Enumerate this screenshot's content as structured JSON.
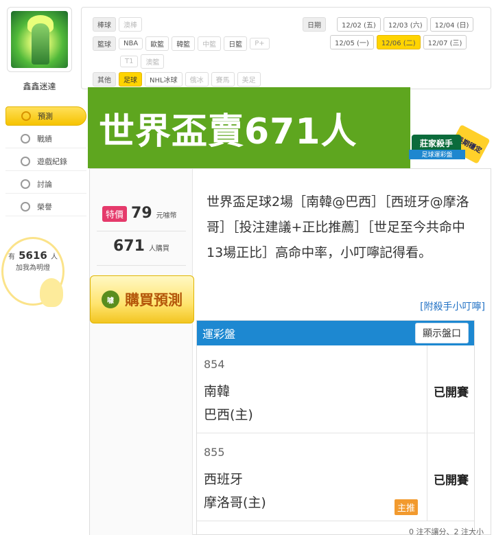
{
  "sidebar": {
    "user_name": "鑫鑫迷達",
    "items": [
      {
        "label": "預測",
        "icon": "target-icon",
        "active": true
      },
      {
        "label": "戰績",
        "icon": "chat-icon"
      },
      {
        "label": "遊戲紀錄",
        "icon": "record-icon"
      },
      {
        "label": "討論",
        "icon": "discuss-icon"
      },
      {
        "label": "榮譽",
        "icon": "medal-icon"
      }
    ],
    "fans": {
      "prefix": "有",
      "count": "5616",
      "suffix": "人",
      "caption": "加我為明燈"
    }
  },
  "filter": {
    "baseball_label": "棒球",
    "baseball_items": [
      "澳棒"
    ],
    "basketball_label": "籃球",
    "basketball_items": [
      "NBA",
      "歐籃",
      "韓籃",
      "中籃",
      "日籃",
      "P+",
      "T1",
      "澳籃"
    ],
    "other_label": "其他",
    "other_items": [
      "足球",
      "NHL冰球",
      "俄冰",
      "賽馬",
      "美足"
    ],
    "date_label": "日期",
    "dates": [
      "12/02 (五)",
      "12/03 (六)",
      "12/04 (日)",
      "12/05 (一)",
      "12/06 (二)",
      "12/07 (三)"
    ],
    "active_date": "12/06 (二)"
  },
  "banner": {
    "title": "世界盃賣671人"
  },
  "badge": {
    "main": "莊家殺手",
    "sub": "足球運彩盤",
    "ribbon": "長期穩定"
  },
  "product": {
    "special_tag": "特價",
    "price": "79",
    "price_unit": "元噱幣",
    "buyers": "671",
    "buyers_unit": "人購買",
    "buy_button": "購買預測",
    "buy_icon": "噱",
    "description": "世界盃足球2場［南韓@巴西］［西班牙@摩洛哥］［投注建議+正比推薦］［世足至今共命中13場正比］高命中率，小叮嚀記得看。",
    "link": "[附殺手小叮嚀]"
  },
  "odds": {
    "title": "運彩盤",
    "show_button": "顯示盤口",
    "games": [
      {
        "no": "854",
        "team1": "南韓",
        "team2": "巴西(主)",
        "status": "已開賽",
        "tag": ""
      },
      {
        "no": "855",
        "team1": "西班牙",
        "team2": "摩洛哥(主)",
        "status": "已開賽",
        "tag": "主推"
      }
    ],
    "bottom_note": "0 注不讓分、2 注大小"
  }
}
